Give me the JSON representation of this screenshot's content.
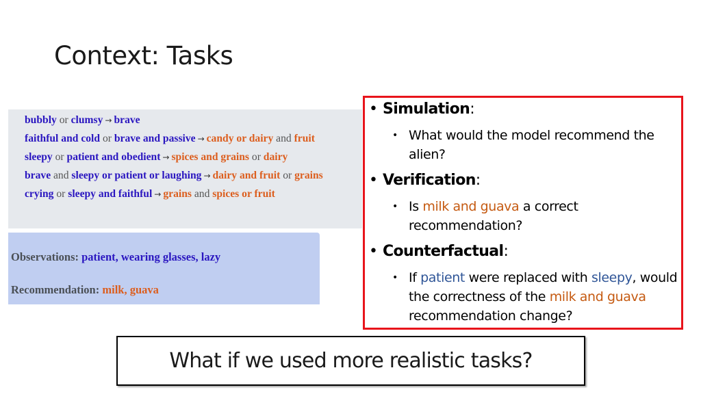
{
  "slide": {
    "title": "Context: Tasks"
  },
  "rules_panel": {
    "arrow": "→",
    "lines": [
      [
        {
          "t": "bubbly",
          "c": "blue"
        },
        {
          "t": " or ",
          "c": "gray"
        },
        {
          "t": "clumsy",
          "c": "blue"
        },
        {
          "t": "→",
          "c": "arrow"
        },
        {
          "t": "brave",
          "c": "blue"
        }
      ],
      [
        {
          "t": "faithful and cold",
          "c": "blue"
        },
        {
          "t": " or ",
          "c": "gray"
        },
        {
          "t": "brave and passive",
          "c": "blue"
        },
        {
          "t": "→",
          "c": "arrow"
        },
        {
          "t": "candy or dairy",
          "c": "orange"
        },
        {
          "t": " and ",
          "c": "gray"
        },
        {
          "t": "fruit",
          "c": "orange"
        }
      ],
      [
        {
          "t": "sleepy",
          "c": "blue"
        },
        {
          "t": " or ",
          "c": "gray"
        },
        {
          "t": "patient and obedient",
          "c": "blue"
        },
        {
          "t": "→",
          "c": "arrow"
        },
        {
          "t": "spices and grains",
          "c": "orange"
        },
        {
          "t": " or ",
          "c": "gray"
        },
        {
          "t": "dairy",
          "c": "orange"
        }
      ],
      [
        {
          "t": "brave",
          "c": "blue"
        },
        {
          "t": " and ",
          "c": "gray"
        },
        {
          "t": "sleepy or patient or laughing",
          "c": "blue"
        },
        {
          "t": "→",
          "c": "arrow"
        },
        {
          "t": "dairy and fruit",
          "c": "orange"
        },
        {
          "t": " or ",
          "c": "gray"
        },
        {
          "t": "grains",
          "c": "orange"
        }
      ],
      [
        {
          "t": "crying",
          "c": "blue"
        },
        {
          "t": " or ",
          "c": "gray"
        },
        {
          "t": "sleepy and faithful",
          "c": "blue"
        },
        {
          "t": "→",
          "c": "arrow"
        },
        {
          "t": "grains",
          "c": "orange"
        },
        {
          "t": " and ",
          "c": "gray"
        },
        {
          "t": "spices or fruit",
          "c": "orange"
        }
      ]
    ]
  },
  "observation_panel": {
    "observations_label": "Observations: ",
    "observations_value": "patient, wearing glasses, lazy",
    "recommendation_label": "Recommendation: ",
    "recommendation_value": "milk, guava"
  },
  "tasks_box": {
    "bullet": "•",
    "colon": ":",
    "simulation": {
      "heading": "Simulation",
      "detail": "What would the model recommend the alien?"
    },
    "verification": {
      "heading": "Verification",
      "detail_pre": "Is ",
      "detail_highlight": "milk and guava",
      "detail_post": " a correct recommendation?"
    },
    "counterfactual": {
      "heading": "Counterfactual",
      "detail_1": "If ",
      "detail_2": "patient",
      "detail_3": " were replaced with ",
      "detail_4": "sleepy",
      "detail_5": ", would the correctness of the ",
      "detail_6": "milk and guava",
      "detail_7": " recommendation change?"
    }
  },
  "question_box": {
    "text": "What if we used more realistic tasks?"
  },
  "colors": {
    "rule_blue": "#2a16c0",
    "rule_orange": "#dc5e1e",
    "highlight_orange": "#c55a11",
    "highlight_blue": "#2f5597",
    "box_red": "#e8141b"
  }
}
